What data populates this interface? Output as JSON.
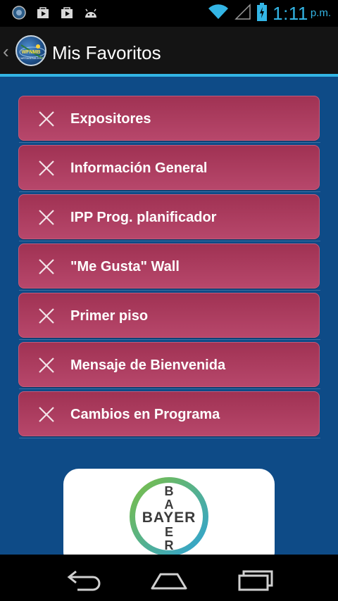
{
  "status_bar": {
    "time": "1:11",
    "ampm": "p.m.",
    "icons": [
      "app-notification-icon",
      "play-store-icon",
      "play-store-icon",
      "android-debug-icon",
      "wifi-icon",
      "signal-icon",
      "battery-charging-icon"
    ]
  },
  "action_bar": {
    "title": "Mis Favoritos",
    "logo_text": "WFNMB",
    "logo_subtext": "CARTAGENA 2013"
  },
  "favorites": [
    {
      "label": "Expositores"
    },
    {
      "label": "Información General"
    },
    {
      "label": "IPP Prog. planificador"
    },
    {
      "label": "\"Me Gusta\" Wall"
    },
    {
      "label": "Primer piso"
    },
    {
      "label": "Mensaje de Bienvenida"
    },
    {
      "label": "Cambios en Programa"
    }
  ],
  "sponsor": {
    "logo_name": "bayer-logo",
    "wordmark": "BAYER"
  },
  "nav_bar": {
    "icons": [
      "back-icon",
      "home-icon",
      "recent-apps-icon"
    ]
  },
  "colors": {
    "accent": "#33b5e5",
    "content_background": "#0e4b87",
    "item_background": "#a93c5f"
  }
}
